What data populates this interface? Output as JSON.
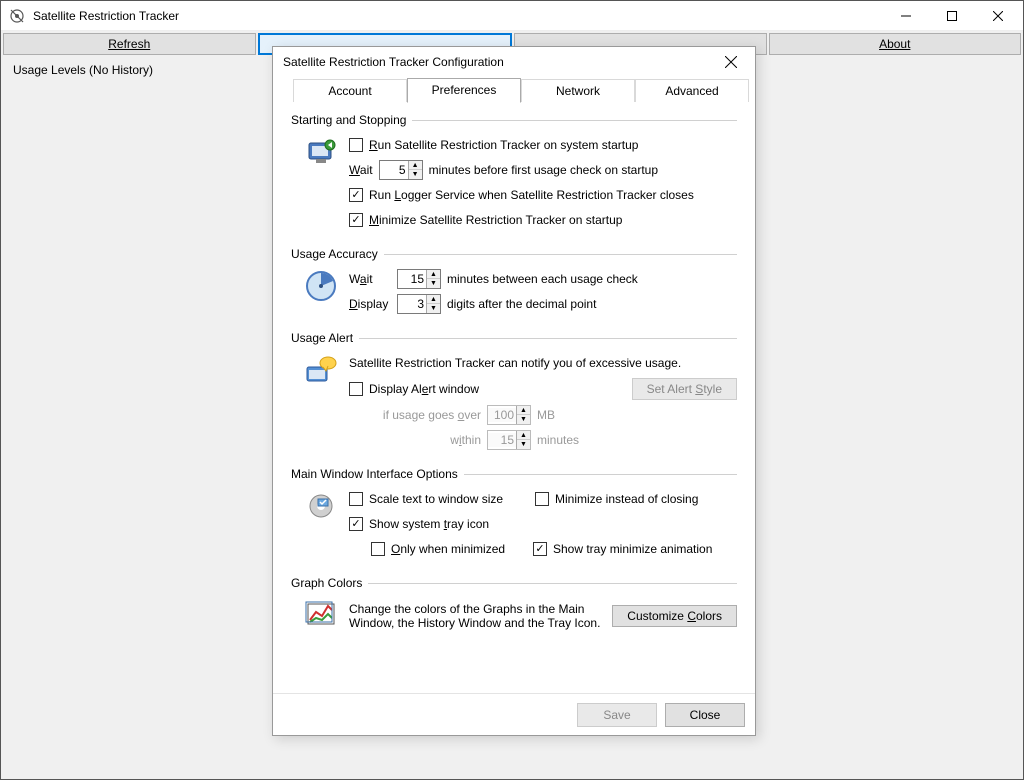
{
  "mainWindow": {
    "title": "Satellite Restriction Tracker",
    "toolbar": {
      "refresh": "Refresh",
      "about": "About"
    },
    "usageLabel": "Usage Levels (No History)"
  },
  "dialog": {
    "title": "Satellite Restriction Tracker Configuration",
    "tabs": {
      "account": "Account",
      "preferences": "Preferences",
      "network": "Network",
      "advanced": "Advanced"
    },
    "starting": {
      "legend": "Starting and Stopping",
      "runOnStartup": {
        "checked": false,
        "label": "Run Satellite Restriction Tracker on system startup"
      },
      "waitLabel": "Wait",
      "waitValue": "5",
      "waitSuffix": "minutes before first usage check on startup",
      "runLogger": {
        "checked": true,
        "label": "Run Logger Service when Satellite Restriction Tracker closes"
      },
      "minimize": {
        "checked": true,
        "label": "Minimize Satellite Restriction Tracker on startup"
      }
    },
    "accuracy": {
      "legend": "Usage Accuracy",
      "waitLabel": "Wait",
      "waitValue": "15",
      "waitSuffix": "minutes between each usage check",
      "displayLabel": "Display",
      "displayValue": "3",
      "displaySuffix": "digits after the decimal point"
    },
    "alert": {
      "legend": "Usage Alert",
      "desc": "Satellite Restriction Tracker can notify you of excessive usage.",
      "displayAlert": {
        "checked": false,
        "label": "Display Alert window"
      },
      "setStyle": "Set Alert Style",
      "overLabel": "if usage goes over",
      "overValue": "100",
      "overUnit": "MB",
      "withinLabel": "within",
      "withinValue": "15",
      "withinUnit": "minutes"
    },
    "interfaceOpts": {
      "legend": "Main Window Interface Options",
      "scale": {
        "checked": false,
        "label": "Scale text to window size"
      },
      "minClose": {
        "checked": false,
        "label": "Minimize instead of closing"
      },
      "tray": {
        "checked": true,
        "label": "Show system tray icon"
      },
      "onlyMin": {
        "checked": false,
        "label": "Only when minimized"
      },
      "trayAnim": {
        "checked": true,
        "label": "Show tray minimize animation"
      }
    },
    "colors": {
      "legend": "Graph Colors",
      "desc": "Change the colors of the Graphs in the Main Window, the History Window and the Tray Icon.",
      "button": "Customize Colors"
    },
    "footer": {
      "save": "Save",
      "close": "Close"
    }
  }
}
